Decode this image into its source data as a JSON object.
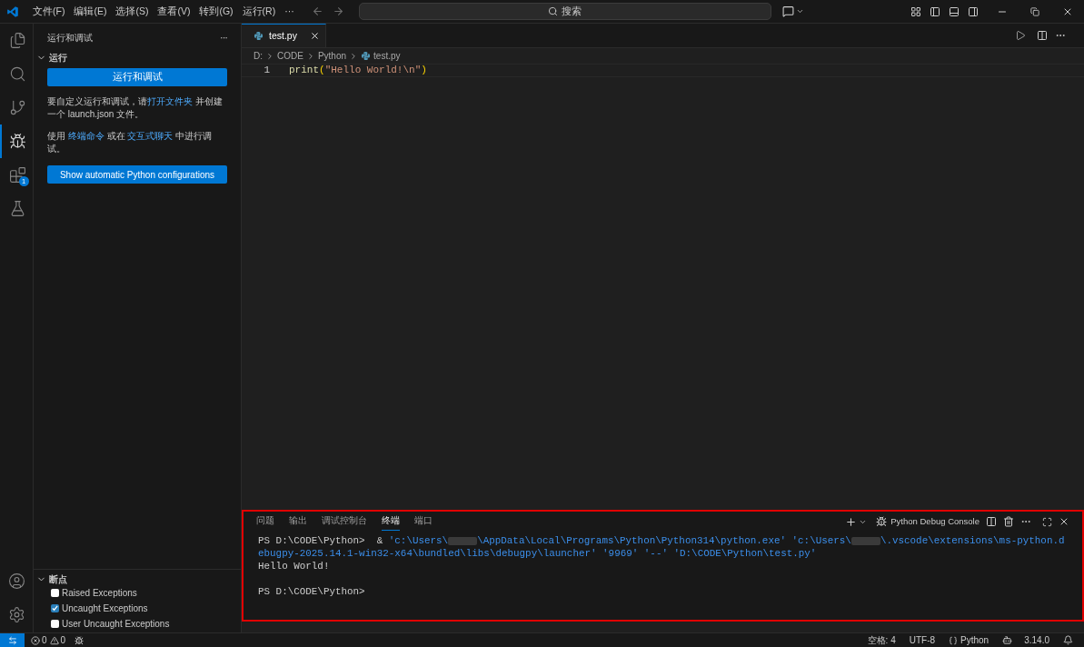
{
  "menu": [
    "文件(F)",
    "编辑(E)",
    "选择(S)",
    "查看(V)",
    "转到(G)",
    "运行(R)",
    "···"
  ],
  "search": {
    "placeholder": "搜索"
  },
  "activity": [
    {
      "kind": "files",
      "selected": false
    },
    {
      "kind": "search",
      "selected": false
    },
    {
      "kind": "git",
      "selected": false
    },
    {
      "kind": "debug",
      "selected": true
    },
    {
      "kind": "extensions",
      "selected": false,
      "badge": "1"
    },
    {
      "kind": "testing",
      "selected": false
    }
  ],
  "sidebar": {
    "title": "运行和调试",
    "more": "···",
    "run_section": {
      "title": "运行",
      "expanded": true
    },
    "run_button": "运行和调试",
    "paragraphs": [
      [
        {
          "kind": "text",
          "text": "要自定义运行和调试，请"
        },
        {
          "kind": "link",
          "text": "打开文件夹"
        },
        {
          "kind": "text",
          "text": " 并创建一个 launch.json 文件。"
        }
      ],
      [
        {
          "kind": "text",
          "text": "使用 "
        },
        {
          "kind": "link",
          "text": "终端命令"
        },
        {
          "kind": "text",
          "text": " 或在 "
        },
        {
          "kind": "link",
          "text": "交互式聊天"
        },
        {
          "kind": "text",
          "text": " 中进行调试。"
        }
      ]
    ],
    "config_button": "Show automatic Python configurations",
    "breakpoints": {
      "title": "断点",
      "expanded": true,
      "items": [
        {
          "label": "Raised Exceptions",
          "checked": false
        },
        {
          "label": "Uncaught Exceptions",
          "checked": true
        },
        {
          "label": "User Uncaught Exceptions",
          "checked": false
        }
      ]
    }
  },
  "editor": {
    "tabs": [
      {
        "label": "test.py",
        "selected": true
      }
    ],
    "breadcrumbs": [
      "D:",
      "CODE",
      "Python",
      "test.py"
    ],
    "lines": [
      {
        "number": "1",
        "tokens": [
          {
            "kind": "function",
            "text": "print"
          },
          {
            "kind": "bracket",
            "text": "("
          },
          {
            "kind": "string",
            "text": "\"Hello World!\\n\""
          },
          {
            "kind": "bracket",
            "text": ")"
          }
        ]
      }
    ]
  },
  "panel": {
    "highlighted": true,
    "tabs": [
      {
        "label": "问题",
        "selected": false
      },
      {
        "label": "输出",
        "selected": false
      },
      {
        "label": "调试控制台",
        "selected": false
      },
      {
        "label": "终端",
        "selected": true
      },
      {
        "label": "端口",
        "selected": false
      }
    ],
    "profile": "Python Debug Console",
    "terminal": [
      {
        "kind": "text",
        "segments": [
          {
            "kind": "prompt",
            "text": "PS D:\\CODE\\Python> "
          },
          {
            "kind": "plain",
            "text": " & "
          },
          {
            "kind": "arg",
            "text": "'c:\\Users\\"
          },
          {
            "kind": "redacted"
          },
          {
            "kind": "arg",
            "text": "\\AppData\\Local\\Programs\\Python\\Python314\\python.exe' "
          },
          {
            "kind": "arg",
            "text": "'c:\\Users\\"
          },
          {
            "kind": "redacted"
          },
          {
            "kind": "arg",
            "text": "\\.vscode\\extensions\\ms-python.debugpy-2025.14.1-win32-x64\\bundled\\libs\\debugpy\\launcher' "
          },
          {
            "kind": "arg",
            "text": "'9969' "
          },
          {
            "kind": "arg",
            "text": "'--' "
          },
          {
            "kind": "arg",
            "text": "'D:\\CODE\\Python\\test.py'"
          }
        ]
      },
      {
        "kind": "text",
        "segments": [
          {
            "kind": "plain",
            "text": "Hello World!"
          }
        ]
      },
      {
        "kind": "blank"
      },
      {
        "kind": "text",
        "segments": [
          {
            "kind": "prompt",
            "text": "PS D:\\CODE\\Python>"
          }
        ]
      }
    ]
  },
  "status_bar": {
    "errors": "0",
    "warnings": "0",
    "right": [
      {
        "kind": "text",
        "text": "空格: 4"
      },
      {
        "kind": "text",
        "text": "UTF-8"
      },
      {
        "kind": "language",
        "text": "Python"
      },
      {
        "kind": "version",
        "text": "3.14.0"
      }
    ]
  }
}
